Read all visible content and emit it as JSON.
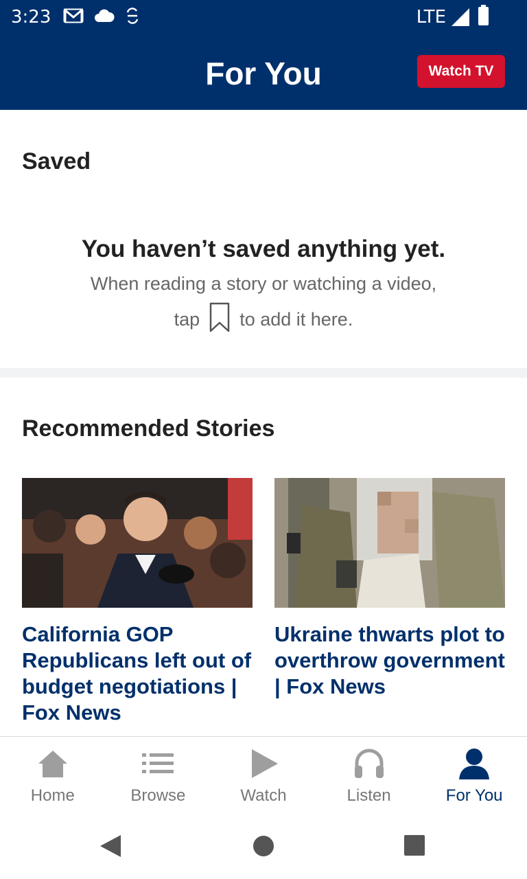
{
  "status_bar": {
    "time": "3:23",
    "network": "LTE"
  },
  "header": {
    "title": "For You",
    "watch_tv_label": "Watch TV"
  },
  "saved": {
    "title": "Saved",
    "empty_title": "You haven’t saved anything yet.",
    "empty_line1": "When reading a story or watching a video,",
    "empty_line2_before": "tap",
    "empty_line2_after": "to add it here."
  },
  "recommended": {
    "title": "Recommended Stories",
    "stories": [
      {
        "headline": "California GOP Republicans left out of budget negotiations | Fox News"
      },
      {
        "headline": "Ukraine thwarts plot to overthrow government | Fox News"
      }
    ]
  },
  "bottom_nav": {
    "items": [
      {
        "label": "Home",
        "icon": "home-icon"
      },
      {
        "label": "Browse",
        "icon": "list-icon"
      },
      {
        "label": "Watch",
        "icon": "play-icon"
      },
      {
        "label": "Listen",
        "icon": "headphones-icon"
      },
      {
        "label": "For You",
        "icon": "person-icon"
      }
    ],
    "active_index": 4
  },
  "colors": {
    "brand_navy": "#00306b",
    "watch_tv_red": "#d3122d",
    "inactive_gray": "#777777"
  }
}
